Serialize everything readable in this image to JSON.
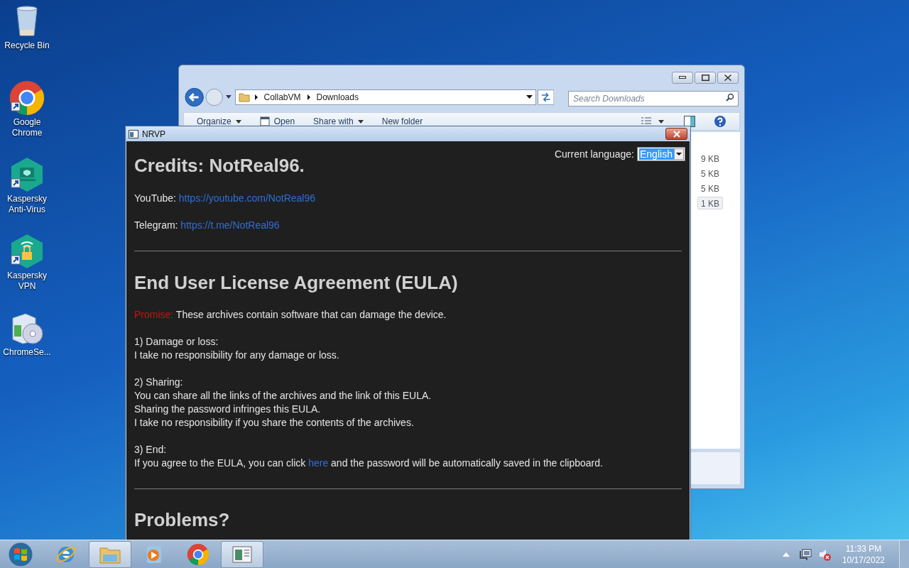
{
  "desktop_icons": [
    {
      "kind": "recycle",
      "label": "Recycle Bin",
      "shortcut": false
    },
    {
      "kind": "chrome",
      "label": "Google Chrome",
      "shortcut": true
    },
    {
      "kind": "antivirus",
      "label": "Kaspersky Anti-Virus",
      "shortcut": true
    },
    {
      "kind": "vpn",
      "label": "Kaspersky VPN",
      "shortcut": true
    },
    {
      "kind": "installer",
      "label": "ChromeSe...",
      "shortcut": false
    }
  ],
  "explorer_window": {
    "breadcrumb": [
      "CollabVM",
      "Downloads"
    ],
    "search": {
      "placeholder": "Search Downloads"
    },
    "toolbar": [
      {
        "label": "Organize",
        "dropdown": true,
        "icon": false
      },
      {
        "label": "Open",
        "dropdown": false,
        "icon": true
      },
      {
        "label": "Share with",
        "dropdown": true,
        "icon": false
      },
      {
        "label": "New folder",
        "dropdown": false,
        "icon": false
      }
    ],
    "sizes": [
      {
        "text": "9 KB",
        "selected": false
      },
      {
        "text": "5 KB",
        "selected": false
      },
      {
        "text": "5 KB",
        "selected": false
      },
      {
        "text": "1 KB",
        "selected": true
      }
    ]
  },
  "nrvp_window": {
    "title": "NRVP",
    "language_label": "Current language:",
    "language_value": "English",
    "credits": {
      "heading": "Credits: NotReal96.",
      "links": [
        {
          "label": "YouTube:",
          "url": "https://youtube.com/NotReal96"
        },
        {
          "label": "Telegram:",
          "url": "https://t.me/NotReal96"
        }
      ]
    },
    "eula": {
      "heading": "End User License Agreement (EULA)",
      "warning": {
        "label": "Promise:",
        "text": "These archives contain software that can damage the device."
      },
      "clauses": [
        {
          "title": "1) Damage or loss:",
          "lines": [
            "I take no responsibility for any damage or loss."
          ]
        },
        {
          "title": "2) Sharing:",
          "lines": [
            "You can share all the links of the archives and the link of this EULA.",
            "Sharing the password infringes this EULA.",
            "I take no responsibility if you share the contents of the archives."
          ]
        },
        {
          "title": "3) End:",
          "link_line": {
            "before": "If you agree to the EULA, you can click",
            "link": "here",
            "after": "and the password will be automatically saved in the clipboard."
          }
        }
      ]
    },
    "problems": {
      "heading": "Problems?"
    }
  },
  "taskbar": {
    "items": [
      {
        "kind": "ie",
        "running": false
      },
      {
        "kind": "folder",
        "running": true
      },
      {
        "kind": "media",
        "running": false
      },
      {
        "kind": "chrome",
        "running": false
      },
      {
        "kind": "app",
        "running": true
      }
    ],
    "clock": {
      "time": "11:33 PM",
      "date": "10/17/2022"
    }
  }
}
